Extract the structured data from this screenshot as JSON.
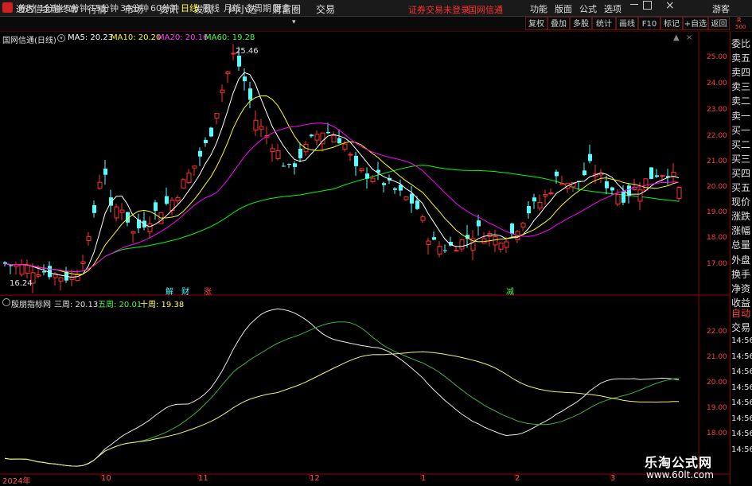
{
  "titlebar": {
    "app_name": "通达信金融终端",
    "menus": [
      "行情",
      "市场",
      "资讯",
      "发现",
      "问小达",
      "财富圈",
      "交易"
    ],
    "warning": "证券交易未登录",
    "warning_stock": "国网信通",
    "right_menus": [
      "功能",
      "版面",
      "公式",
      "选项"
    ],
    "guest": "游客"
  },
  "periods": [
    "分时",
    "1分钟",
    "5分钟",
    "15分钟",
    "30分钟",
    "60分钟",
    "日线",
    "周线",
    "月线",
    "多周期",
    "更多"
  ],
  "active_period": "日线",
  "toolbar": [
    "复权",
    "叠加",
    "多股",
    "统计",
    "画线",
    "F10",
    "标记",
    "+自选",
    "返回"
  ],
  "main_chart": {
    "stock": "国网信通",
    "period_label": "(日线)",
    "ma5": "MA5: 20.23",
    "ma10": "MA10: 20.20",
    "ma20": "MA20: 20.16",
    "ma60": "MA60: 19.28",
    "high_label": "25.46",
    "low_label": "16.24",
    "colors": {
      "ma5": "#ffffff",
      "ma10": "#ffff00",
      "ma20": "#ff00ff",
      "ma60": "#00ff00",
      "up": "#ff3030",
      "down": "#54ffff"
    },
    "y_ticks": [
      "25.00",
      "24.00",
      "23.00",
      "22.00",
      "21.00",
      "20.00",
      "19.00",
      "18.00",
      "17.00"
    ],
    "markers": [
      "解",
      "财",
      "涨",
      "减"
    ]
  },
  "sub_chart": {
    "name": "殷朋指标网",
    "l1": "三周: 20.13",
    "l2": "五周: 20.01",
    "l3": "十周: 19.38",
    "y_ticks": [
      "22.00",
      "21.00",
      "20.00",
      "19.00",
      "18.00"
    ]
  },
  "x_labels": [
    "2024年",
    "10",
    "11",
    "12",
    "1",
    "2",
    "3"
  ],
  "right_panel": {
    "top_code": "R",
    "top_num": "500",
    "items": [
      "委比",
      "卖五",
      "卖四",
      "卖三",
      "卖二",
      "卖一",
      "买一",
      "买二",
      "买三",
      "买四",
      "买五",
      "现价",
      "涨跌",
      "涨幅",
      "总量",
      "外盘",
      "换手",
      "净资",
      "收益"
    ],
    "bottom": [
      "自动",
      "交易"
    ],
    "times": [
      "14:56",
      "14:56",
      "14:56",
      "14:56",
      "14:56",
      "14:56",
      "14:56",
      "14:56"
    ]
  },
  "watermark": {
    "title": "乐淘公式网",
    "url": "www.60lt.com"
  }
}
